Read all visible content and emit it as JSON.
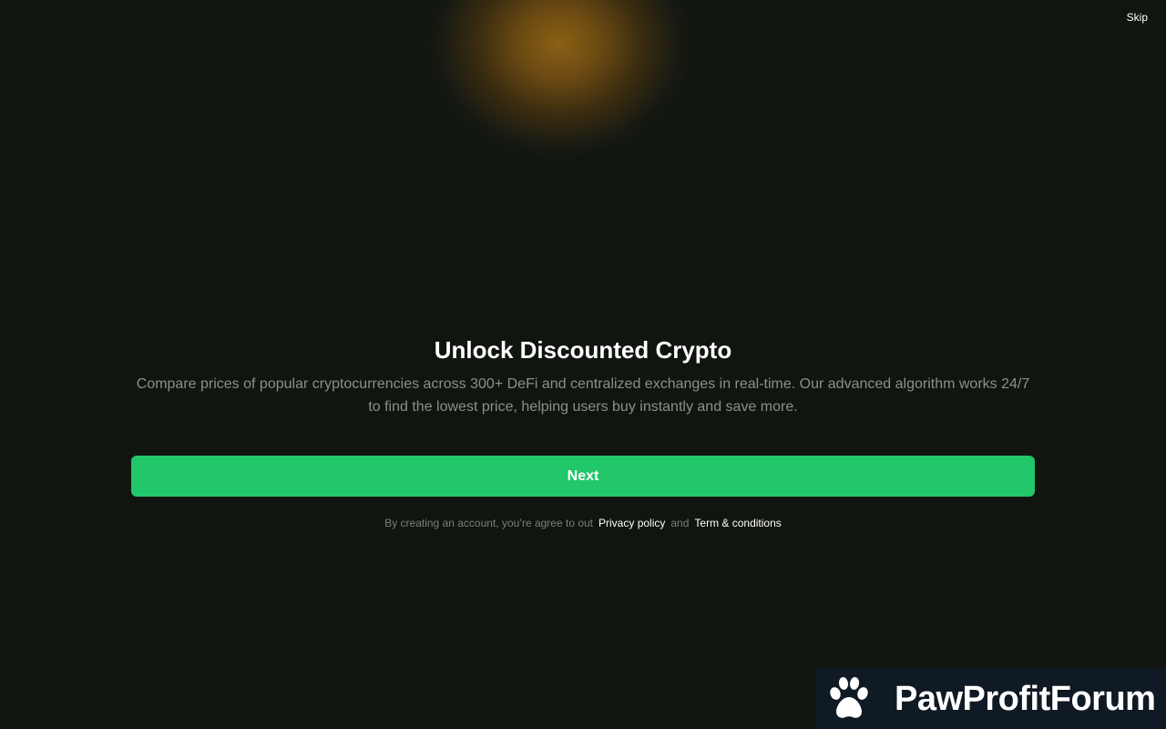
{
  "header": {
    "skip_label": "Skip"
  },
  "onboarding": {
    "title": "Unlock Discounted Crypto",
    "description_line1": "Compare prices of popular cryptocurrencies across 300+ DeFi and centralized exchanges in real-time. Our advanced algorithm works 24/7",
    "description_line2": "to find the lowest price, helping users buy instantly and save more.",
    "next_label": "Next"
  },
  "legal": {
    "prefix": "By creating an account, you’re agree to out",
    "privacy_label": "Privacy policy",
    "and": "and",
    "terms_label": "Term & conditions"
  },
  "watermark": {
    "brand": "PawProfitForum",
    "icon": "paw-icon"
  },
  "colors": {
    "background": "#111510",
    "accent": "#22c76a",
    "glow": "#8a6014",
    "muted_text": "#8c8f8b"
  }
}
